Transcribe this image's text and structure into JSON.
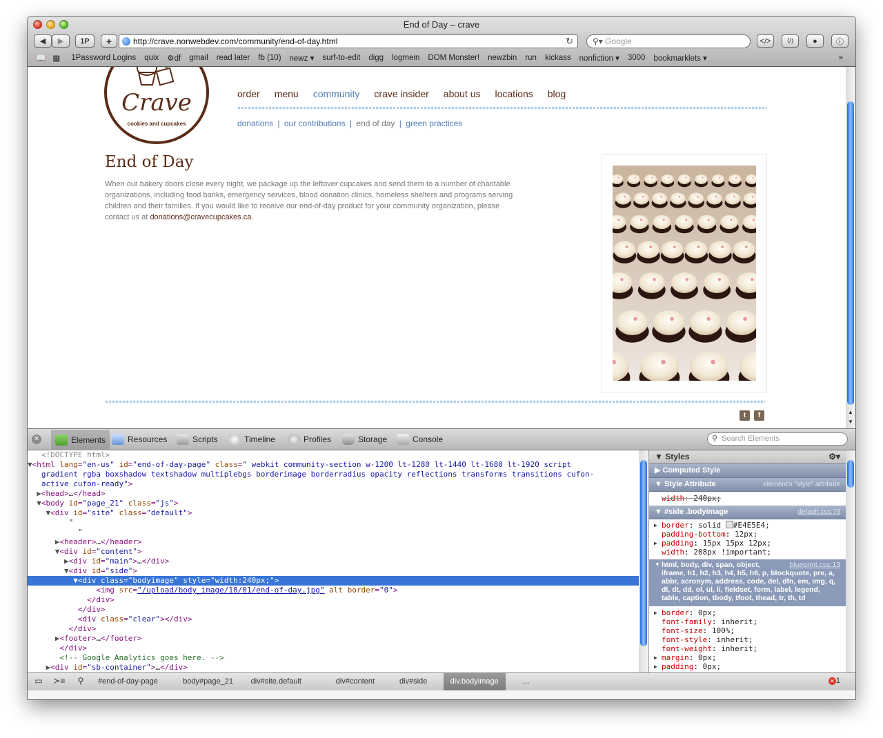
{
  "window": {
    "title": "End of Day – crave"
  },
  "toolbar": {
    "back": "◀",
    "forward": "▶",
    "onepassword": "1P",
    "add": "+",
    "url": "http://crave.nonwebdev.com/community/end-of-day.html",
    "search_placeholder": "Google",
    "ext_buttons": [
      "</>",
      "⟨/⟩",
      "●",
      "ⓘ"
    ]
  },
  "bookmarks": [
    "1Password Logins",
    "quix",
    "⚙df",
    "gmail",
    "read later",
    "fb (10)",
    "newz ▾",
    "surf-to-edit",
    "digg",
    "logmein",
    "DOM Monster!",
    "newzbin",
    "run",
    "kickass",
    "nonfiction ▾",
    "3000",
    "bookmarklets ▾"
  ],
  "site": {
    "logo_brand": "Crave",
    "logo_tagline": "cookies and cupcakes",
    "nav": [
      "order",
      "menu",
      "community",
      "crave insider",
      "about us",
      "locations",
      "blog"
    ],
    "nav_active": "community",
    "subnav": [
      "donations",
      "our contributions",
      "end of day",
      "green practices"
    ],
    "subnav_separator": "|",
    "heading": "End of Day",
    "body_text": "When our bakery doors close every night, we package up the leftover cupcakes and send them to a number of charitable organizations, including food banks, emergency services, blood donation clinics, homeless shelters and programs serving children and their families. If you would like to receive our end-of-day product for your community organization, please contact us at ",
    "email": "donations@cravecupcakes.ca",
    "body_end": ".",
    "social": [
      "t",
      "f"
    ]
  },
  "inspector": {
    "tabs": [
      "Elements",
      "Resources",
      "Scripts",
      "Timeline",
      "Profiles",
      "Storage",
      "Console"
    ],
    "search_placeholder": "Search Elements",
    "dom_lines": [
      {
        "indent": "  ",
        "tw": "",
        "parts": [
          [
            "dt",
            "<!DOCTYPE html>"
          ]
        ]
      },
      {
        "indent": "",
        "tw": "▼",
        "parts": [
          [
            "tg",
            "<html "
          ],
          [
            "at",
            "lang"
          ],
          [
            "tg",
            "="
          ],
          [
            "av",
            "\"en-us\""
          ],
          [
            "tg",
            " "
          ],
          [
            "at",
            "id"
          ],
          [
            "tg",
            "="
          ],
          [
            "av",
            "\"end-of-day-page\""
          ],
          [
            "tg",
            " "
          ],
          [
            "at",
            "class"
          ],
          [
            "tg",
            "="
          ],
          [
            "av",
            "\" webkit community-section w-1200 lt-1280 lt-1440 lt-1680 lt-1920 script"
          ]
        ]
      },
      {
        "indent": "  ",
        "tw": "",
        "parts": [
          [
            "av",
            "gradient rgba boxshadow textshadow multiplebgs borderimage borderradius opacity reflections transforms transitions cufon-"
          ]
        ]
      },
      {
        "indent": "  ",
        "tw": "",
        "parts": [
          [
            "av",
            "active cufon-ready\""
          ],
          [
            "tg",
            ">"
          ]
        ]
      },
      {
        "indent": "  ",
        "tw": "▶",
        "parts": [
          [
            "tg",
            "<head>"
          ],
          [
            "tx",
            "…"
          ],
          [
            "tg",
            "</head>"
          ]
        ]
      },
      {
        "indent": "  ",
        "tw": "▼",
        "parts": [
          [
            "tg",
            "<body "
          ],
          [
            "at",
            "id"
          ],
          [
            "tg",
            "="
          ],
          [
            "av",
            "\"page_21\""
          ],
          [
            "tg",
            " "
          ],
          [
            "at",
            "class"
          ],
          [
            "tg",
            "="
          ],
          [
            "av",
            "\"js\""
          ],
          [
            "tg",
            ">"
          ]
        ]
      },
      {
        "indent": "    ",
        "tw": "▼",
        "parts": [
          [
            "tg",
            "<div "
          ],
          [
            "at",
            "id"
          ],
          [
            "tg",
            "="
          ],
          [
            "av",
            "\"site\""
          ],
          [
            "tg",
            " "
          ],
          [
            "at",
            "class"
          ],
          [
            "tg",
            "="
          ],
          [
            "av",
            "\"default\""
          ],
          [
            "tg",
            ">"
          ]
        ]
      },
      {
        "indent": "        ",
        "tw": "",
        "parts": [
          [
            "tx",
            "\""
          ]
        ]
      },
      {
        "indent": "          ",
        "tw": "",
        "parts": [
          [
            "tx",
            "\""
          ]
        ]
      },
      {
        "indent": "      ",
        "tw": "▶",
        "parts": [
          [
            "tg",
            "<header>"
          ],
          [
            "tx",
            "…"
          ],
          [
            "tg",
            "</header>"
          ]
        ]
      },
      {
        "indent": "      ",
        "tw": "▼",
        "parts": [
          [
            "tg",
            "<div "
          ],
          [
            "at",
            "id"
          ],
          [
            "tg",
            "="
          ],
          [
            "av",
            "\"content\""
          ],
          [
            "tg",
            ">"
          ]
        ]
      },
      {
        "indent": "        ",
        "tw": "▶",
        "parts": [
          [
            "tg",
            "<div "
          ],
          [
            "at",
            "id"
          ],
          [
            "tg",
            "="
          ],
          [
            "av",
            "\"main\""
          ],
          [
            "tg",
            ">"
          ],
          [
            "tx",
            "…"
          ],
          [
            "tg",
            "</div>"
          ]
        ]
      },
      {
        "indent": "        ",
        "tw": "▼",
        "parts": [
          [
            "tg",
            "<div "
          ],
          [
            "at",
            "id"
          ],
          [
            "tg",
            "="
          ],
          [
            "av",
            "\"side\""
          ],
          [
            "tg",
            ">"
          ]
        ]
      },
      {
        "indent": "          ",
        "tw": "▼",
        "sel": true,
        "parts": [
          [
            "tg",
            "<div "
          ],
          [
            "at",
            "class"
          ],
          [
            "tg",
            "="
          ],
          [
            "av",
            "\"bodyimage\""
          ],
          [
            "tg",
            " "
          ],
          [
            "at",
            "style"
          ],
          [
            "tg",
            "="
          ],
          [
            "av",
            "\"width:240px;\""
          ],
          [
            "tg",
            ">"
          ]
        ]
      },
      {
        "indent": "              ",
        "tw": "",
        "parts": [
          [
            "tg",
            "<img "
          ],
          [
            "at",
            "src"
          ],
          [
            "tg",
            "="
          ],
          [
            "av",
            "\"/upload/body_image/18/01/end-of-day.jpg\""
          ],
          [
            "tg",
            " "
          ],
          [
            "at",
            "alt"
          ],
          [
            "tg",
            " "
          ],
          [
            "at",
            "border"
          ],
          [
            "tg",
            "="
          ],
          [
            "av",
            "\"0\""
          ],
          [
            "tg",
            ">"
          ]
        ]
      },
      {
        "indent": "            ",
        "tw": "",
        "parts": [
          [
            "tg",
            "</div>"
          ]
        ]
      },
      {
        "indent": "          ",
        "tw": "",
        "parts": [
          [
            "tg",
            "</div>"
          ]
        ]
      },
      {
        "indent": "          ",
        "tw": "",
        "parts": [
          [
            "tg",
            "<div "
          ],
          [
            "at",
            "class"
          ],
          [
            "tg",
            "="
          ],
          [
            "av",
            "\"clear\""
          ],
          [
            "tg",
            ">"
          ],
          [
            "tg",
            "</div>"
          ]
        ]
      },
      {
        "indent": "        ",
        "tw": "",
        "parts": [
          [
            "tg",
            "</div>"
          ]
        ]
      },
      {
        "indent": "      ",
        "tw": "▶",
        "parts": [
          [
            "tg",
            "<footer>"
          ],
          [
            "tx",
            "…"
          ],
          [
            "tg",
            "</footer>"
          ]
        ]
      },
      {
        "indent": "      ",
        "tw": "",
        "parts": [
          [
            "tg",
            "</div>"
          ]
        ]
      },
      {
        "indent": "      ",
        "tw": "",
        "parts": [
          [
            "cm",
            "<!-- Google Analytics goes here. -->"
          ]
        ]
      },
      {
        "indent": "    ",
        "tw": "▶",
        "parts": [
          [
            "tg",
            "<div "
          ],
          [
            "at",
            "id"
          ],
          [
            "tg",
            "="
          ],
          [
            "av",
            "\"sb-container\""
          ],
          [
            "tg",
            ">"
          ],
          [
            "tx",
            "…"
          ],
          [
            "tg",
            "</div>"
          ]
        ]
      }
    ],
    "styles": {
      "title": "Styles",
      "computed": "Computed Style",
      "style_attr": {
        "label": "Style Attribute",
        "src": "element's \"style\" attribute",
        "props": [
          [
            "width",
            "240px;"
          ]
        ]
      },
      "rule1": {
        "selector": "#side .bodyimage",
        "src": "default.css:73",
        "props": [
          [
            "border",
            "solid",
            "#E4E5E4;"
          ],
          [
            "padding-bottom",
            "12px;"
          ],
          [
            "padding",
            "15px 15px 12px;"
          ],
          [
            "width",
            "208px !important;"
          ]
        ]
      },
      "rule2": {
        "selector": "html, body, div, span, object, iframe, h1, h2, h3, h4, h5, h6, p, blockquote, pre, a, abbr, acronym, address, code, del, dfn, em, img, q, dl, dt, dd, ol, ul, li, fieldset, form, label, legend, table, caption, tbody, tfoot, thead, tr, th, td",
        "src": "blueprint.css:13",
        "props": [
          [
            "border",
            "0px;"
          ],
          [
            "font-family",
            "inherit;"
          ],
          [
            "font-size",
            "100%;"
          ],
          [
            "font-style",
            "inherit;"
          ],
          [
            "font-weight",
            "inherit;"
          ],
          [
            "margin",
            "0px;"
          ],
          [
            "padding",
            "0px;"
          ]
        ]
      }
    },
    "breadcrumbs": [
      "#end-of-day-page",
      "body#page_21",
      "div#site.default",
      "div#content",
      "div#side",
      "div.bodyimage",
      "…"
    ],
    "error_count": "1",
    "colors": {
      "swatch": "#E4E5E4",
      "selection": "#3875d7"
    }
  }
}
